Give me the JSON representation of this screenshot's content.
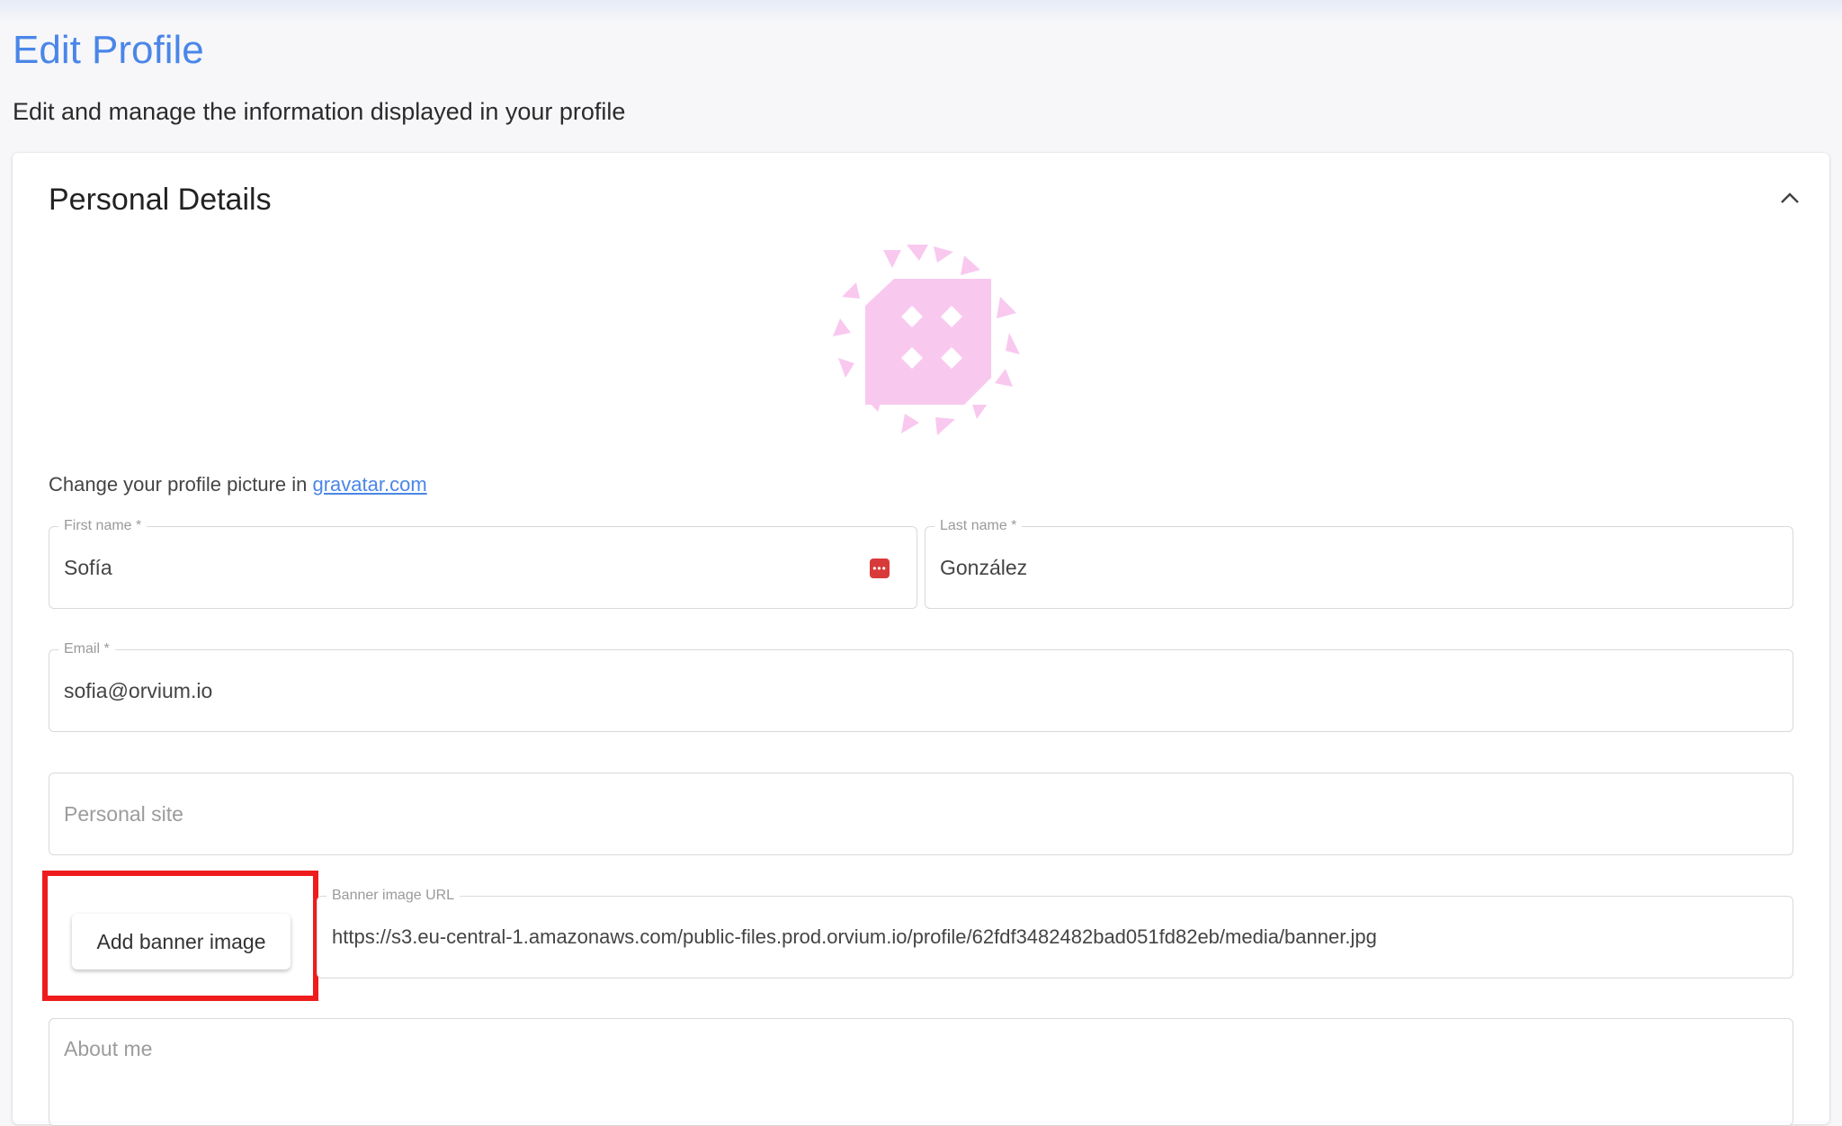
{
  "header": {
    "title": "Edit Profile",
    "subtitle": "Edit and manage the information displayed in your profile"
  },
  "card": {
    "title": "Personal Details",
    "collapse_icon": "chevron-up-icon"
  },
  "avatar": {
    "icon": "identicon",
    "color": "#f9c8ef"
  },
  "gravatar": {
    "text": "Change your profile picture in ",
    "link_label": "gravatar.com"
  },
  "form": {
    "first_name": {
      "label": "First name *",
      "value": "Sofía",
      "icon": "password-manager-icon"
    },
    "last_name": {
      "label": "Last name *",
      "value": "González"
    },
    "email": {
      "label": "Email *",
      "value": "sofia@orvium.io"
    },
    "personal_site": {
      "placeholder": "Personal site"
    },
    "banner_button": {
      "label": "Add banner image"
    },
    "banner_url": {
      "label": "Banner image URL",
      "value": "https://s3.eu-central-1.amazonaws.com/public-files.prod.orvium.io/profile/62fdf3482482bad051fd82eb/media/banner.jpg"
    },
    "about_me": {
      "placeholder": "About me"
    }
  },
  "colors": {
    "accent": "#4a86e8",
    "highlight": "#ee1c1c",
    "password_icon": "#d83a3a"
  }
}
